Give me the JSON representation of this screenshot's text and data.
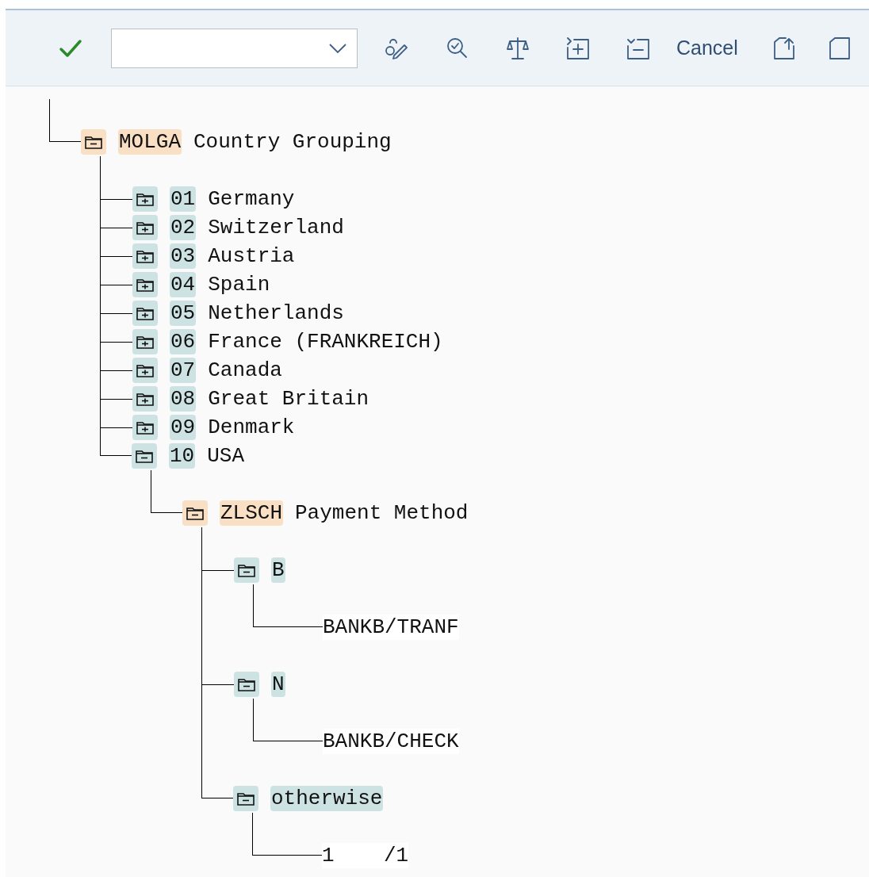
{
  "toolbar": {
    "cancel_button": "Cancel"
  },
  "tree": {
    "kind": "field",
    "key": "MOLGA",
    "text": "Country Grouping",
    "expanded": true,
    "children": [
      {
        "kind": "value",
        "key": "01",
        "text": "Germany",
        "expanded": false
      },
      {
        "kind": "value",
        "key": "02",
        "text": "Switzerland",
        "expanded": false
      },
      {
        "kind": "value",
        "key": "03",
        "text": "Austria",
        "expanded": false
      },
      {
        "kind": "value",
        "key": "04",
        "text": "Spain",
        "expanded": false
      },
      {
        "kind": "value",
        "key": "05",
        "text": "Netherlands",
        "expanded": false
      },
      {
        "kind": "value",
        "key": "06",
        "text": "France (FRANKREICH)",
        "expanded": false
      },
      {
        "kind": "value",
        "key": "07",
        "text": "Canada",
        "expanded": false
      },
      {
        "kind": "value",
        "key": "08",
        "text": "Great Britain",
        "expanded": false
      },
      {
        "kind": "value",
        "key": "09",
        "text": "Denmark",
        "expanded": false
      },
      {
        "kind": "value",
        "key": "10",
        "text": "USA",
        "expanded": true,
        "children": [
          {
            "kind": "field",
            "key": "ZLSCH",
            "text": "Payment Method",
            "expanded": true,
            "children": [
              {
                "kind": "value",
                "key": "B",
                "expanded": true,
                "children": [
                  {
                    "kind": "result",
                    "text": "BANKB/TRANF"
                  }
                ]
              },
              {
                "kind": "value",
                "key": "N",
                "expanded": true,
                "children": [
                  {
                    "kind": "result",
                    "text": "BANKB/CHECK"
                  }
                ]
              },
              {
                "kind": "value",
                "key": "otherwise",
                "expanded": true,
                "children": [
                  {
                    "kind": "result",
                    "text": "1    /1"
                  }
                ]
              }
            ]
          }
        ]
      }
    ]
  }
}
